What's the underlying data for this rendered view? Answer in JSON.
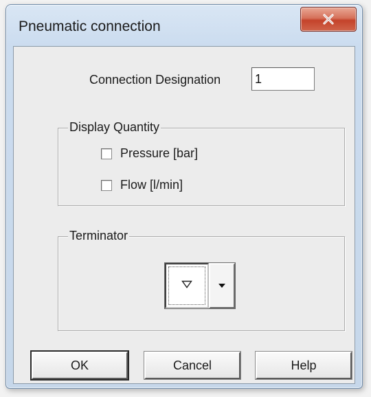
{
  "window": {
    "title": "Pneumatic connection"
  },
  "designation": {
    "label": "Connection Designation",
    "value": "1"
  },
  "display_quantity": {
    "legend": "Display Quantity",
    "options": [
      {
        "label": "Pressure [bar]",
        "checked": false
      },
      {
        "label": "Flow [l/min]",
        "checked": false
      }
    ]
  },
  "terminator": {
    "legend": "Terminator",
    "selected_icon": "triangle-down-outline-icon"
  },
  "buttons": {
    "ok": "OK",
    "cancel": "Cancel",
    "help": "Help"
  },
  "colors": {
    "close_button": "#c4432b",
    "title_bar": "#cbdcef",
    "dialog_face": "#ececec"
  }
}
